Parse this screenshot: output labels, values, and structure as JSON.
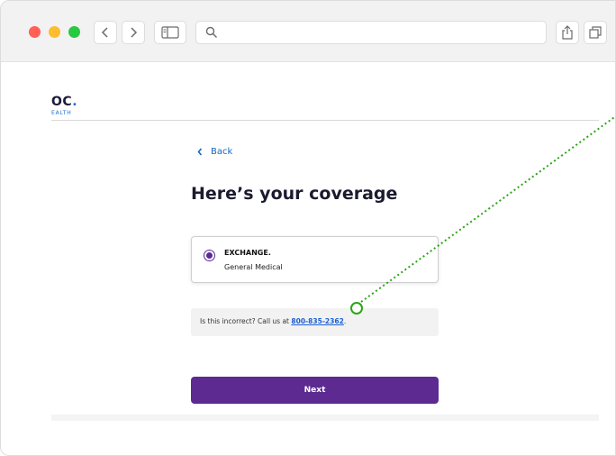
{
  "logo": {
    "mark": "OC",
    "mark_dot": ".",
    "sub": "EALTH"
  },
  "nav": {
    "back_label": "Back"
  },
  "page": {
    "title": "Here’s your coverage"
  },
  "plan": {
    "name": "EXCHANGE.",
    "subtitle": "General Medical",
    "selected": true
  },
  "info": {
    "prefix": "Is this incorrect? Call us at ",
    "phone": "800-835-2362",
    "suffix": "."
  },
  "actions": {
    "next_label": "Next"
  },
  "icons": {
    "traffic_lights": [
      "close-light-icon",
      "minimize-light-icon",
      "zoom-light-icon"
    ],
    "toolbar": [
      "chevron-left-icon",
      "chevron-right-icon",
      "sidebar-icon",
      "search-icon",
      "share-icon",
      "tabs-icon"
    ]
  },
  "colors": {
    "primary_purple": "#5c2a91",
    "link_blue": "#1565c0",
    "annotation_green": "#2aa514",
    "traffic_red": "#ff5f57",
    "traffic_yellow": "#febc2e",
    "traffic_green": "#28c840"
  }
}
